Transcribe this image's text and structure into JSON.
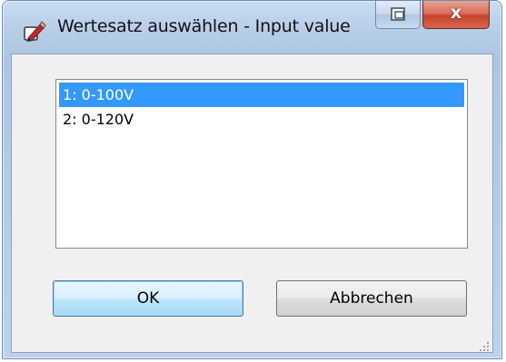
{
  "window": {
    "title": "Wertesatz auswählen - Input value",
    "icon": "pencil-edit-icon",
    "close_glyph": "x"
  },
  "list": {
    "items": [
      {
        "label": "1: 0-100V",
        "selected": true
      },
      {
        "label": "2: 0-120V",
        "selected": false
      }
    ]
  },
  "buttons": {
    "ok_label": "OK",
    "cancel_label": "Abbrechen"
  },
  "colors": {
    "selection": "#3399ff",
    "close_button": "#c7442c",
    "title_bar": "#b9cfe8"
  }
}
